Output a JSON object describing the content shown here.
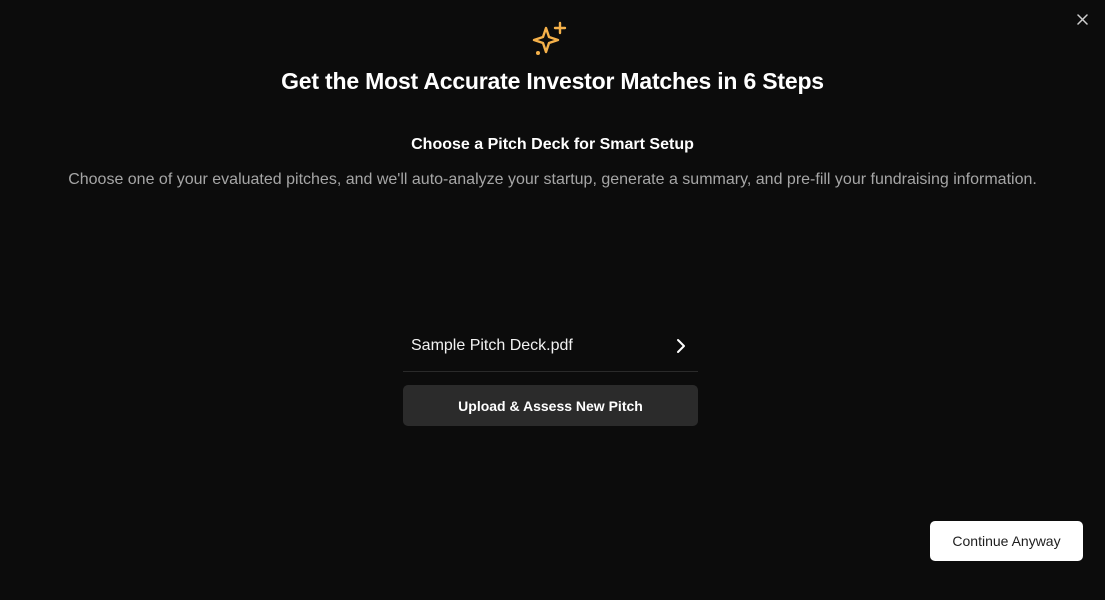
{
  "modal": {
    "title": "Get the Most Accurate Investor Matches in 6 Steps",
    "subtitle": "Choose a Pitch Deck for Smart Setup",
    "description": "Choose one of your evaluated pitches, and we'll auto-analyze your startup, generate a summary, and pre-fill your fundraising information."
  },
  "decks": [
    {
      "name": "Sample Pitch Deck.pdf"
    }
  ],
  "actions": {
    "upload_label": "Upload & Assess New Pitch",
    "continue_label": "Continue Anyway"
  },
  "icons": {
    "header": "sparkle-icon",
    "close": "close-icon",
    "deck_arrow": "chevron-right-icon"
  },
  "colors": {
    "background": "#0c0c0c",
    "accent": "#f5b14a",
    "muted_text": "#a6a6a6",
    "secondary_button": "#2b2b2b",
    "primary_button": "#ffffff"
  }
}
